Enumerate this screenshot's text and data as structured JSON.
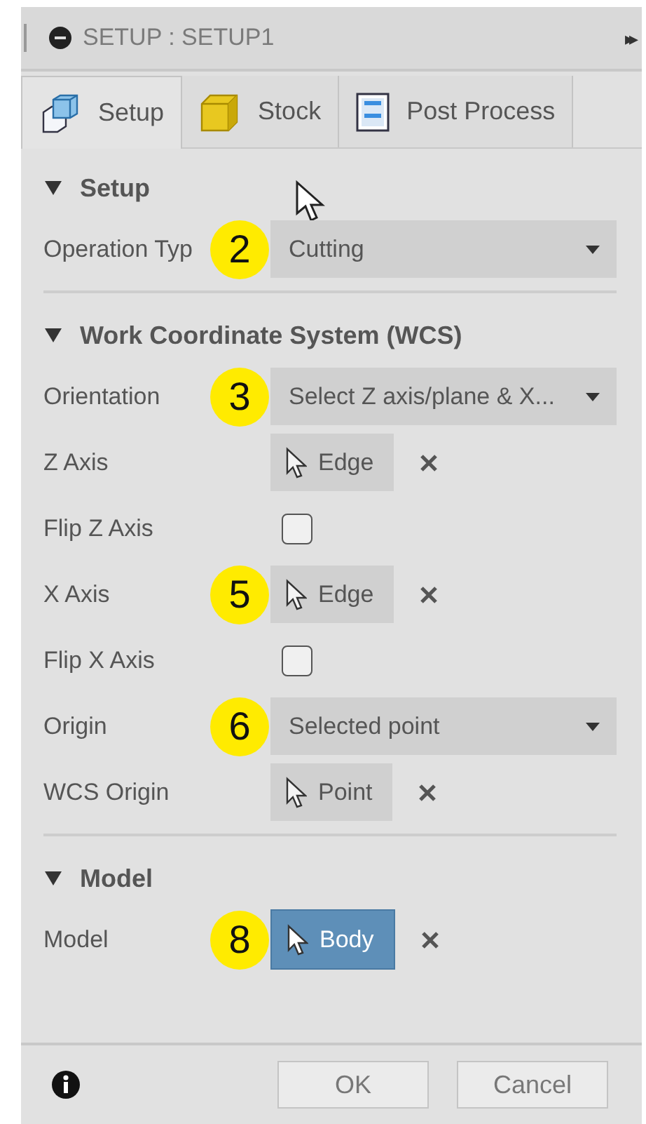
{
  "title_bar": {
    "title": "SETUP : SETUP1",
    "expand_glyph": "▸▸"
  },
  "tabs": [
    {
      "label": "Setup",
      "selected": true
    },
    {
      "label": "Stock",
      "selected": false
    },
    {
      "label": "Post Process",
      "selected": false
    }
  ],
  "sections": [
    {
      "title": "Setup",
      "expanded": true,
      "rows": [
        {
          "kind": "dropdown",
          "label": "Operation Typ",
          "value": "Cutting",
          "badge": "2"
        }
      ]
    },
    {
      "title": "Work Coordinate System (WCS)",
      "expanded": true,
      "rows": [
        {
          "kind": "dropdown",
          "label": "Orientation",
          "value": "Select Z axis/plane & X...",
          "badge": "3"
        },
        {
          "kind": "selection",
          "label": "Z Axis",
          "value": "Edge",
          "selected": false
        },
        {
          "kind": "checkbox",
          "label": "Flip Z Axis",
          "checked": false
        },
        {
          "kind": "selection",
          "label": "X Axis",
          "value": "Edge",
          "selected": false,
          "badge": "5"
        },
        {
          "kind": "checkbox",
          "label": "Flip X Axis",
          "checked": false
        },
        {
          "kind": "dropdown",
          "label": "Origin",
          "value": "Selected point",
          "badge": "6"
        },
        {
          "kind": "selection",
          "label": "WCS Origin",
          "value": "Point",
          "selected": false
        }
      ]
    },
    {
      "title": "Model",
      "expanded": true,
      "rows": [
        {
          "kind": "selection",
          "label": "Model",
          "value": "Body",
          "selected": true,
          "badge": "8"
        }
      ]
    }
  ],
  "footer": {
    "buttons": [
      "OK",
      "Cancel"
    ]
  }
}
